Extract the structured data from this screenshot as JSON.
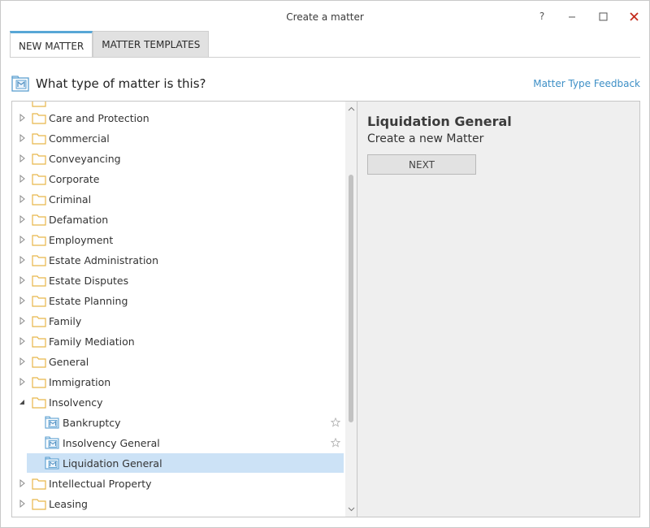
{
  "window": {
    "title": "Create a matter",
    "help": "?",
    "controls": {
      "minimize": "–",
      "maximize": "☐",
      "close": "✕"
    }
  },
  "tabs": [
    {
      "label": "NEW MATTER",
      "active": true
    },
    {
      "label": "MATTER TEMPLATES",
      "active": false
    }
  ],
  "header": {
    "question": "What type of matter is this?",
    "feedback_link": "Matter Type Feedback"
  },
  "tree": {
    "items": [
      {
        "label": "Care and Protection",
        "type": "folder",
        "expanded": false
      },
      {
        "label": "Commercial",
        "type": "folder",
        "expanded": false
      },
      {
        "label": "Conveyancing",
        "type": "folder",
        "expanded": false
      },
      {
        "label": "Corporate",
        "type": "folder",
        "expanded": false
      },
      {
        "label": "Criminal",
        "type": "folder",
        "expanded": false
      },
      {
        "label": "Defamation",
        "type": "folder",
        "expanded": false
      },
      {
        "label": "Employment",
        "type": "folder",
        "expanded": false
      },
      {
        "label": "Estate Administration",
        "type": "folder",
        "expanded": false
      },
      {
        "label": "Estate Disputes",
        "type": "folder",
        "expanded": false
      },
      {
        "label": "Estate Planning",
        "type": "folder",
        "expanded": false
      },
      {
        "label": "Family",
        "type": "folder",
        "expanded": false
      },
      {
        "label": "Family Mediation",
        "type": "folder",
        "expanded": false
      },
      {
        "label": "General",
        "type": "folder",
        "expanded": false
      },
      {
        "label": "Immigration",
        "type": "folder",
        "expanded": false
      },
      {
        "label": "Insolvency",
        "type": "folder",
        "expanded": true
      },
      {
        "label": "Bankruptcy",
        "type": "matter",
        "starred": false
      },
      {
        "label": "Insolvency General",
        "type": "matter",
        "starred": false
      },
      {
        "label": "Liquidation General",
        "type": "matter",
        "selected": true
      },
      {
        "label": "Intellectual Property",
        "type": "folder",
        "expanded": false
      },
      {
        "label": "Leasing",
        "type": "folder",
        "expanded": false
      }
    ]
  },
  "detail": {
    "title": "Liquidation General",
    "subtitle": "Create a new Matter",
    "next_button": "NEXT"
  },
  "colors": {
    "accent": "#58a7d6",
    "link": "#3d8fc6",
    "selection": "#cce2f6",
    "folder": "#e8b64a",
    "close": "#c42b1c"
  }
}
